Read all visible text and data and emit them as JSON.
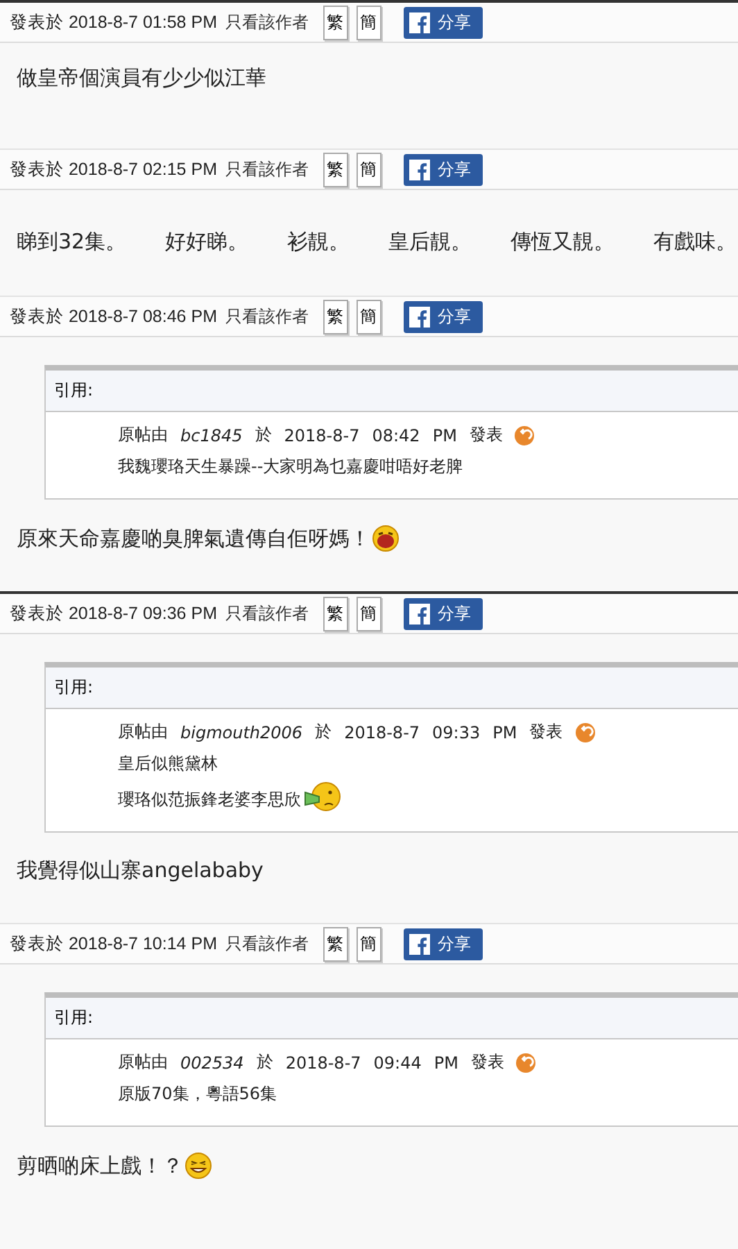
{
  "posts": [
    {
      "new_page": true,
      "posted": "發表於 2018-8-7 01:58 PM",
      "author_only": "只看該作者",
      "trad": "繁",
      "simp": "簡",
      "share": "分享",
      "message": [
        {
          "parts": [
            "做皇帝個演員有少少似江華"
          ]
        }
      ]
    },
    {
      "new_page": false,
      "posted": "發表於 2018-8-7 02:15 PM",
      "author_only": "只看該作者",
      "trad": "繁",
      "simp": "簡",
      "share": "分享",
      "message": [
        {
          "parts": [
            "睇到32集。",
            "好好睇。",
            "衫靚。",
            "皇后靚。",
            "傳恆又靚。",
            "有戲味。"
          ]
        }
      ]
    },
    {
      "new_page": false,
      "posted": "發表於 2018-8-7 08:46 PM",
      "author_only": "只看該作者",
      "trad": "繁",
      "simp": "簡",
      "share": "分享",
      "quote": {
        "label": "引用:",
        "by_label": "原帖由",
        "author": "bc1845",
        "at_label": "於",
        "date": "2018-8-7",
        "time": "08:42",
        "ampm": "PM",
        "posted_label": "發表",
        "lines": [
          {
            "text": "我魏瓔珞天生暴躁--大家明為乜嘉慶咁唔好老脾"
          }
        ]
      },
      "message": [
        {
          "parts": [
            "原來天命嘉慶啲臭脾氣遺傳自佢呀媽！"
          ],
          "emoticon": {
            "kind": "laugh"
          }
        }
      ]
    },
    {
      "new_page": true,
      "posted": "發表於 2018-8-7 09:36 PM",
      "author_only": "只看該作者",
      "trad": "繁",
      "simp": "簡",
      "share": "分享",
      "quote": {
        "label": "引用:",
        "by_label": "原帖由",
        "author": "bigmouth2006",
        "at_label": "於",
        "date": "2018-8-7",
        "time": "09:33",
        "ampm": "PM",
        "posted_label": "發表",
        "lines": [
          {
            "text": "皇后似熊黛林"
          },
          {
            "text": "瓔珞似范振鋒老婆李思欣",
            "emoticon": {
              "kind": "megaphone"
            }
          }
        ]
      },
      "message": [
        {
          "parts": [
            "我覺得似山寨angelababy"
          ]
        }
      ]
    },
    {
      "new_page": false,
      "posted": "發表於 2018-8-7 10:14 PM",
      "author_only": "只看該作者",
      "trad": "繁",
      "simp": "簡",
      "share": "分享",
      "quote": {
        "label": "引用:",
        "by_label": "原帖由",
        "author": "002534",
        "at_label": "於",
        "date": "2018-8-7",
        "time": "09:44",
        "ampm": "PM",
        "posted_label": "發表",
        "lines": [
          {
            "text": "原版70集，粵語56集"
          }
        ]
      },
      "message": [
        {
          "parts": [
            "剪晒啲床上戲！？"
          ],
          "emoticon": {
            "kind": "grin"
          }
        }
      ]
    }
  ]
}
